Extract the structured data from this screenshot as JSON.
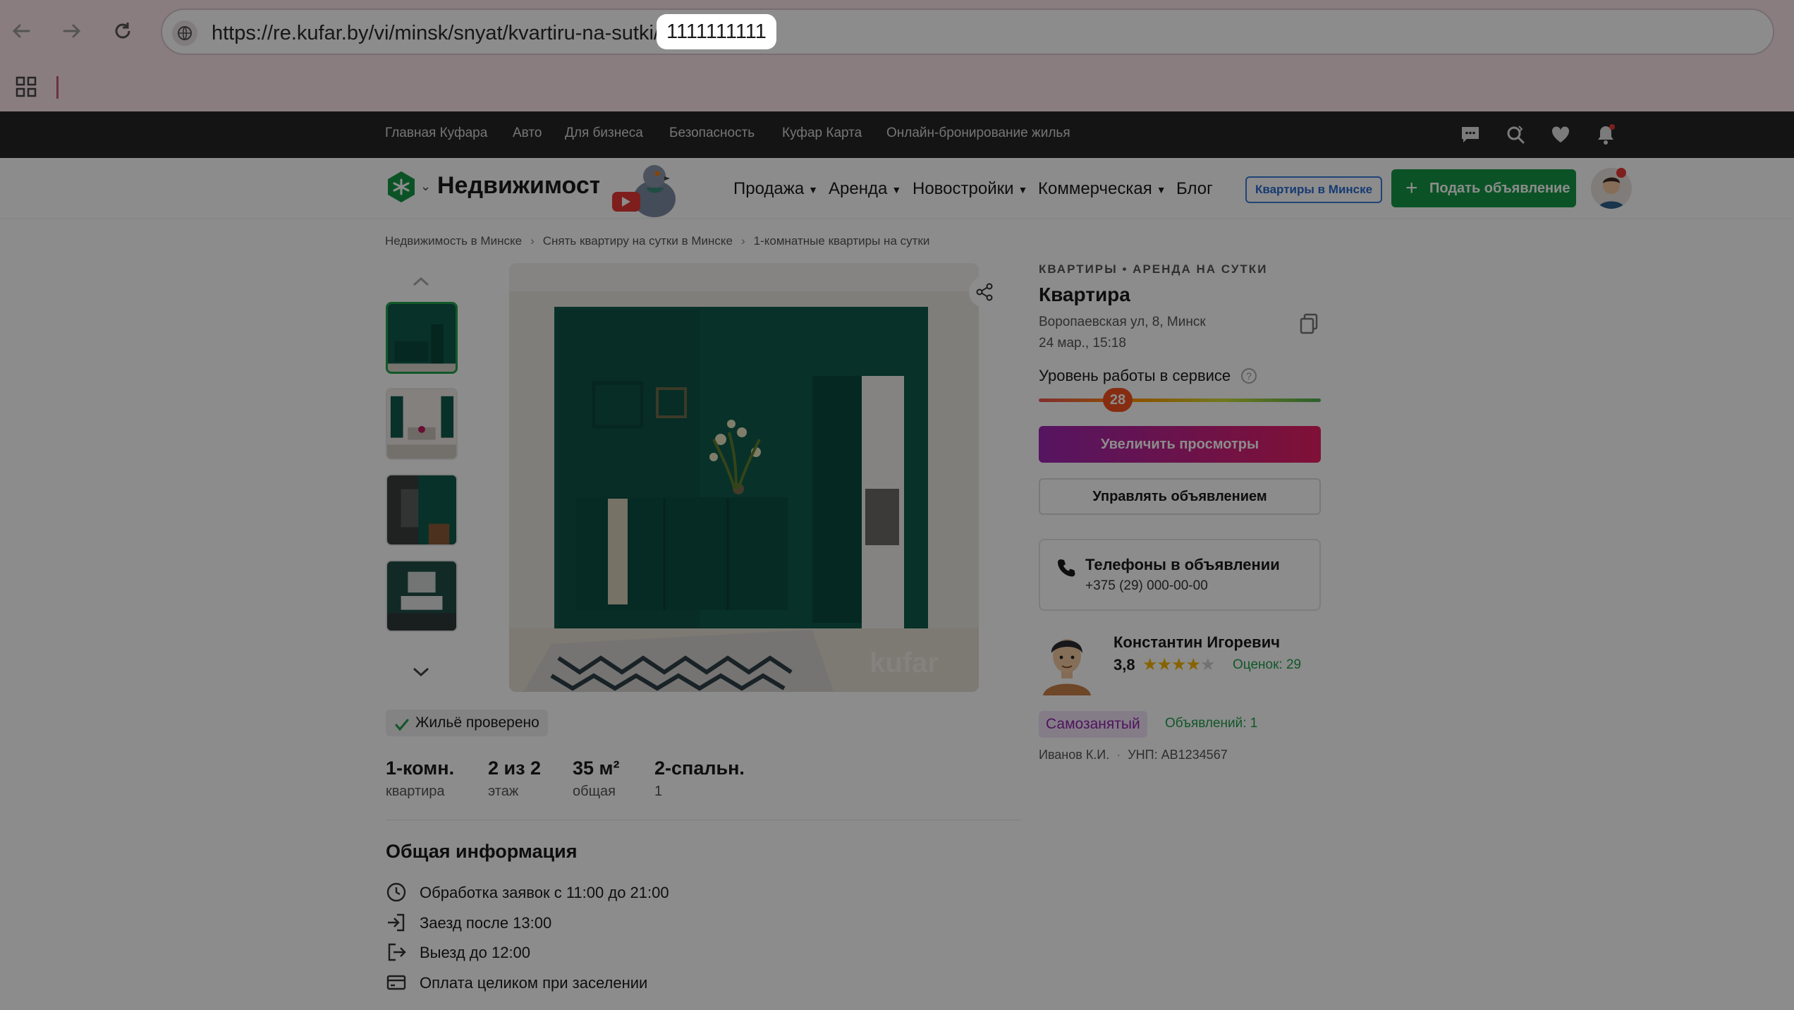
{
  "browser": {
    "url_prefix": "https://re.kufar.by/vi/minsk/snyat/kvartiru-na-sutki/",
    "url_id": "1111111111"
  },
  "topnav": {
    "links": [
      "Главная Куфара",
      "Авто",
      "Для бизнеса",
      "Безопасность",
      "Куфар Карта",
      "Онлайн-бронирование жилья"
    ]
  },
  "header": {
    "brand": "Недвижимость",
    "menu": [
      "Продажа",
      "Аренда",
      "Новостройки",
      "Коммерческая",
      "Блог"
    ],
    "city_button": "Квартиры в Минске",
    "post_button": "Подать объявление"
  },
  "breadcrumbs": [
    "Недвижимость в Минске",
    "Снять квартиру на сутки в Минске",
    "1-комнатные квартиры на сутки"
  ],
  "listing": {
    "category": "КВАРТИРЫ • АРЕНДА НА СУТКИ",
    "title": "Квартира",
    "address": "Воропаевская ул, 8, Минск",
    "date": "24 мар., 15:18",
    "service_level_label": "Уровень работы в сервисе",
    "service_level_value": "28",
    "boost_button": "Увеличить просмотры",
    "manage_button": "Управлять объявлением",
    "phones_title": "Телефоны в объявлении",
    "phone": "+375 (29) 000-00-00",
    "verified": "Жильё проверено"
  },
  "seller": {
    "name": "Константин Игоревич",
    "rating": "3,8",
    "reviews": "Оценок: 29",
    "badge": "Самозанятый",
    "ads": "Объявлений: 1",
    "legal_name": "Иванов К.И.",
    "unp": "УНП: АВ1234567"
  },
  "params": [
    {
      "value": "1-комн.",
      "label": "квартира"
    },
    {
      "value": "2 из 2",
      "label": "этаж"
    },
    {
      "value": "35 м²",
      "label": "общая"
    },
    {
      "value": "2-спальн.",
      "label": "1"
    }
  ],
  "general": {
    "title": "Общая информация",
    "rows": [
      "Обработка заявок с 11:00 до 21:00",
      "Заезд после 13:00",
      "Выезд до 12:00",
      "Оплата целиком при заселении"
    ]
  },
  "watermark": "kufar",
  "colors": {
    "accent_green": "#159745",
    "boost_from": "#9c27b0",
    "boost_to": "#e91e63",
    "wall_green": "#0f5a4c"
  }
}
